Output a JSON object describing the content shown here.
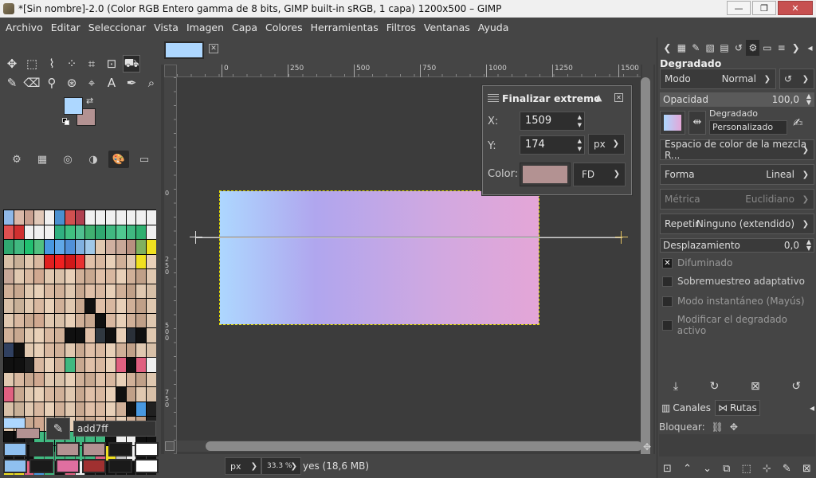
{
  "window": {
    "title": "*[Sin nombre]-2.0 (Color RGB Entero gamma de 8 bits, GIMP built-in sRGB, 1 capa) 1200x500 – GIMP",
    "minimize": "—",
    "maximize": "❐",
    "close": "✕"
  },
  "menu": [
    "Archivo",
    "Editar",
    "Seleccionar",
    "Vista",
    "Imagen",
    "Capa",
    "Colores",
    "Herramientas",
    "Filtros",
    "Ventanas",
    "Ayuda"
  ],
  "toolbox": {
    "row1": [
      "✥",
      "⬚",
      "⌇",
      "⁘",
      "⌗",
      "⊡",
      "⛟"
    ],
    "row2": [
      "✎",
      "⌫",
      "⚲",
      "⊛",
      "⌖",
      "A",
      "✒",
      "⌕"
    ],
    "fg_color": "#add7ff",
    "bg_color": "#b39292",
    "palette_tabs": [
      "⚙",
      "▦",
      "◎",
      "◑",
      "🎨",
      "▭"
    ]
  },
  "palette_colors": [
    "#8fb8e8",
    "#d9b8a8",
    "#c8a090",
    "#e0c8b8",
    "#f0f0f0",
    "#4a90d0",
    "#d05050",
    "#b04050",
    "#f0f0f0",
    "#f0f0f0",
    "#f0f0f0",
    "#f0f0f0",
    "#f0f0f0",
    "#f0f0f0",
    "#f0f0f0",
    "#e05050",
    "#d03030",
    "#f0f0f0",
    "#f0f0f0",
    "#f0f0f0",
    "#30b080",
    "#40c080",
    "#50c090",
    "#40b070",
    "#30a870",
    "#40b880",
    "#50c890",
    "#40b880",
    "#30b070",
    "#f0f0f0",
    "#30a870",
    "#40b880",
    "#20c070",
    "#50c080",
    "#4898e0",
    "#60a8e8",
    "#5090d8",
    "#80b0e0",
    "#a0c8e8",
    "#e0c8b0",
    "#d0b0a0",
    "#c8a898",
    "#b89080",
    "#80b060",
    "#f0e020",
    "#d8c0a8",
    "#c8b098",
    "#e0c8b0",
    "#d8b8a0",
    "#e02020",
    "#f02020",
    "#d01818",
    "#e83030",
    "#e0c0a8",
    "#d8b8a0",
    "#e8d0b8",
    "#d0b098",
    "#e0c8b0",
    "#f0e020",
    "#e8d0b8",
    "#c8a898",
    "#e0c8b0",
    "#d8b8a0",
    "#d0a890",
    "#e0c8b0",
    "#d8c0a8",
    "#e8d0b8",
    "#d0b098",
    "#c8a890",
    "#e0c0a8",
    "#d8b8a0",
    "#e8d0b8",
    "#d0b098",
    "#c0a088",
    "#e0c8b0",
    "#d0b098",
    "#c8a890",
    "#e0c8b0",
    "#e8d0b8",
    "#d8b8a0",
    "#d0b098",
    "#e0c8b0",
    "#c8a890",
    "#e0c0a8",
    "#d8b8a0",
    "#e8d0b8",
    "#d0b098",
    "#c0a088",
    "#e0c8b0",
    "#d8c0a8",
    "#d8c0a8",
    "#c8b098",
    "#e0c8b0",
    "#d8b8a0",
    "#e8d0b8",
    "#d0b098",
    "#e0c8b0",
    "#c8a890",
    "#101010",
    "#e0c0a8",
    "#d8b8a0",
    "#e8d0b8",
    "#d0b098",
    "#c0a088",
    "#e0c8b0",
    "#e0c8b0",
    "#d8b8a0",
    "#c8a890",
    "#d0a890",
    "#e0c8b0",
    "#d8c0a8",
    "#e8d0b8",
    "#d0b098",
    "#c8a890",
    "#101010",
    "#d8b8a0",
    "#e8d0b8",
    "#d0b098",
    "#c0a088",
    "#e0c8b0",
    "#d0b098",
    "#c8a890",
    "#e0c8b0",
    "#e8d0b8",
    "#d8b8a0",
    "#d0b098",
    "#101010",
    "#101010",
    "#e0c0a8",
    "#303840",
    "#101010",
    "#e8d0b8",
    "#2a3038",
    "#101010",
    "#e0c8b0",
    "#304060",
    "#101010",
    "#e0c8b0",
    "#e8d0b8",
    "#d8b8a0",
    "#d0b098",
    "#e0c8b0",
    "#c8a890",
    "#e0c0a8",
    "#d8b8a0",
    "#e8d0b8",
    "#d0b098",
    "#c0a088",
    "#e0c8b0",
    "#d8c0a8",
    "#101010",
    "#101010",
    "#202020",
    "#d8b8a0",
    "#e8d0b8",
    "#d0b098",
    "#40b880",
    "#c8a890",
    "#e0c0a8",
    "#d8b8a0",
    "#e8d0b8",
    "#e06080",
    "#101010",
    "#e06080",
    "#f0f0f0",
    "#e0c8b0",
    "#d8b8a0",
    "#c8a890",
    "#d0a890",
    "#e0c8b0",
    "#d8c0a8",
    "#e8d0b8",
    "#d0b098",
    "#c8a890",
    "#e0c0a8",
    "#d8b8a0",
    "#e8d0b8",
    "#d0b098",
    "#c0a088",
    "#e0c8b0",
    "#e06080",
    "#c8a890",
    "#e0c8b0",
    "#e8d0b8",
    "#d8b8a0",
    "#d0b098",
    "#e0c8b0",
    "#c8a890",
    "#e0c0a8",
    "#d8b8a0",
    "#e8d0b8",
    "#101010",
    "#c0a088",
    "#e0c8b0",
    "#d8c0a8",
    "#d8c0a8",
    "#c8b098",
    "#e0c8b0",
    "#d8b8a0",
    "#e8d0b8",
    "#d0b098",
    "#e0c8b0",
    "#c8a890",
    "#e0c0a8",
    "#d8b8a0",
    "#e8d0b8",
    "#d0b098",
    "#101010",
    "#4898e0",
    "#202020",
    "#e0c8b0",
    "#d8b8a0",
    "#c8a890",
    "#d0a890",
    "#e0c8b0",
    "#d8c0a8",
    "#e8d0b8",
    "#d0b098",
    "#c8a890",
    "#e0c0a8",
    "#d8b8a0",
    "#e8d0b8",
    "#d0b098",
    "#c0a088",
    "#202020",
    "#101010",
    "#101010",
    "#202020",
    "#40b880",
    "#40b880",
    "#40b880",
    "#40b880",
    "#40b880",
    "#40b880",
    "#40b880",
    "#101010",
    "#f0f0f0",
    "#f0f0f0",
    "#101010",
    "#101010",
    "#101010",
    "#101010",
    "#101010",
    "#40b880",
    "#40b880",
    "#40b880",
    "#40b880",
    "#40b880",
    "#40b880",
    "#e06080",
    "#f0e020",
    "#c0c0c0",
    "#f0f0f0",
    "#101010",
    "#101010",
    "#f0e020",
    "#f0e020",
    "#e06080",
    "#4898e0",
    "#40b880",
    "#101010",
    "#e06080",
    "#f0f0f0",
    "#101010",
    "#101010",
    "#101010",
    "#101010",
    "#101010",
    "#101010",
    "#101010"
  ],
  "colors_panel": {
    "hex_value": "add7ff",
    "recent": [
      "#8fc0ef",
      "#2a2a2a",
      "#b39292",
      "#b39292",
      "#1a1a1a",
      "#ffffff",
      "#8fc0ef",
      "#1a1a1a",
      "#e06fa0",
      "#a03030",
      "#1a1a1a",
      "#ffffff"
    ]
  },
  "canvas": {
    "ruler_ticks": [
      "0",
      "250",
      "500",
      "750",
      "1000",
      "1250",
      "1500"
    ],
    "left_ticks": [
      "0",
      "2 5 0",
      "5 0 0",
      "7 5 0"
    ],
    "status_unit": "px",
    "status_zoom": "33.3 %",
    "status_text": "yes (18,6 MB)",
    "gradient_start": "#add7ff",
    "gradient_end": "#e4a6d7"
  },
  "endpoint_panel": {
    "title": "Finalizar extremo",
    "x_label": "X:",
    "x_value": "1509",
    "y_label": "Y:",
    "y_value": "174",
    "unit": "px",
    "color_label": "Color:",
    "color_value": "#b39292",
    "color_type": "FD"
  },
  "tool_options": {
    "title": "Degradado",
    "mode_label": "Modo",
    "mode_value": "Normal",
    "opacity_label": "Opacidad",
    "opacity_value": "100,0",
    "gradient_label": "Degradado",
    "gradient_name": "Personalizado",
    "blend_space": "Espacio de color de la mezcla R...",
    "shape_label": "Forma",
    "shape_value": "Lineal",
    "metric_label": "Métrica",
    "metric_value": "Euclidiano",
    "repeat_label": "Repetir",
    "repeat_value": "Ninguno (extendido)",
    "offset_label": "Desplazamiento",
    "offset_value": "0,0",
    "dither_label": "Difuminado",
    "supersample_label": "Sobremuestreo adaptativo",
    "instant_label": "Modo instantáneo (Mayús)",
    "modify_label": "Modificar el degradado activo"
  },
  "channels_paths": {
    "channels_tab": "Canales",
    "paths_tab": "Rutas",
    "lock_label": "Bloquear:"
  }
}
